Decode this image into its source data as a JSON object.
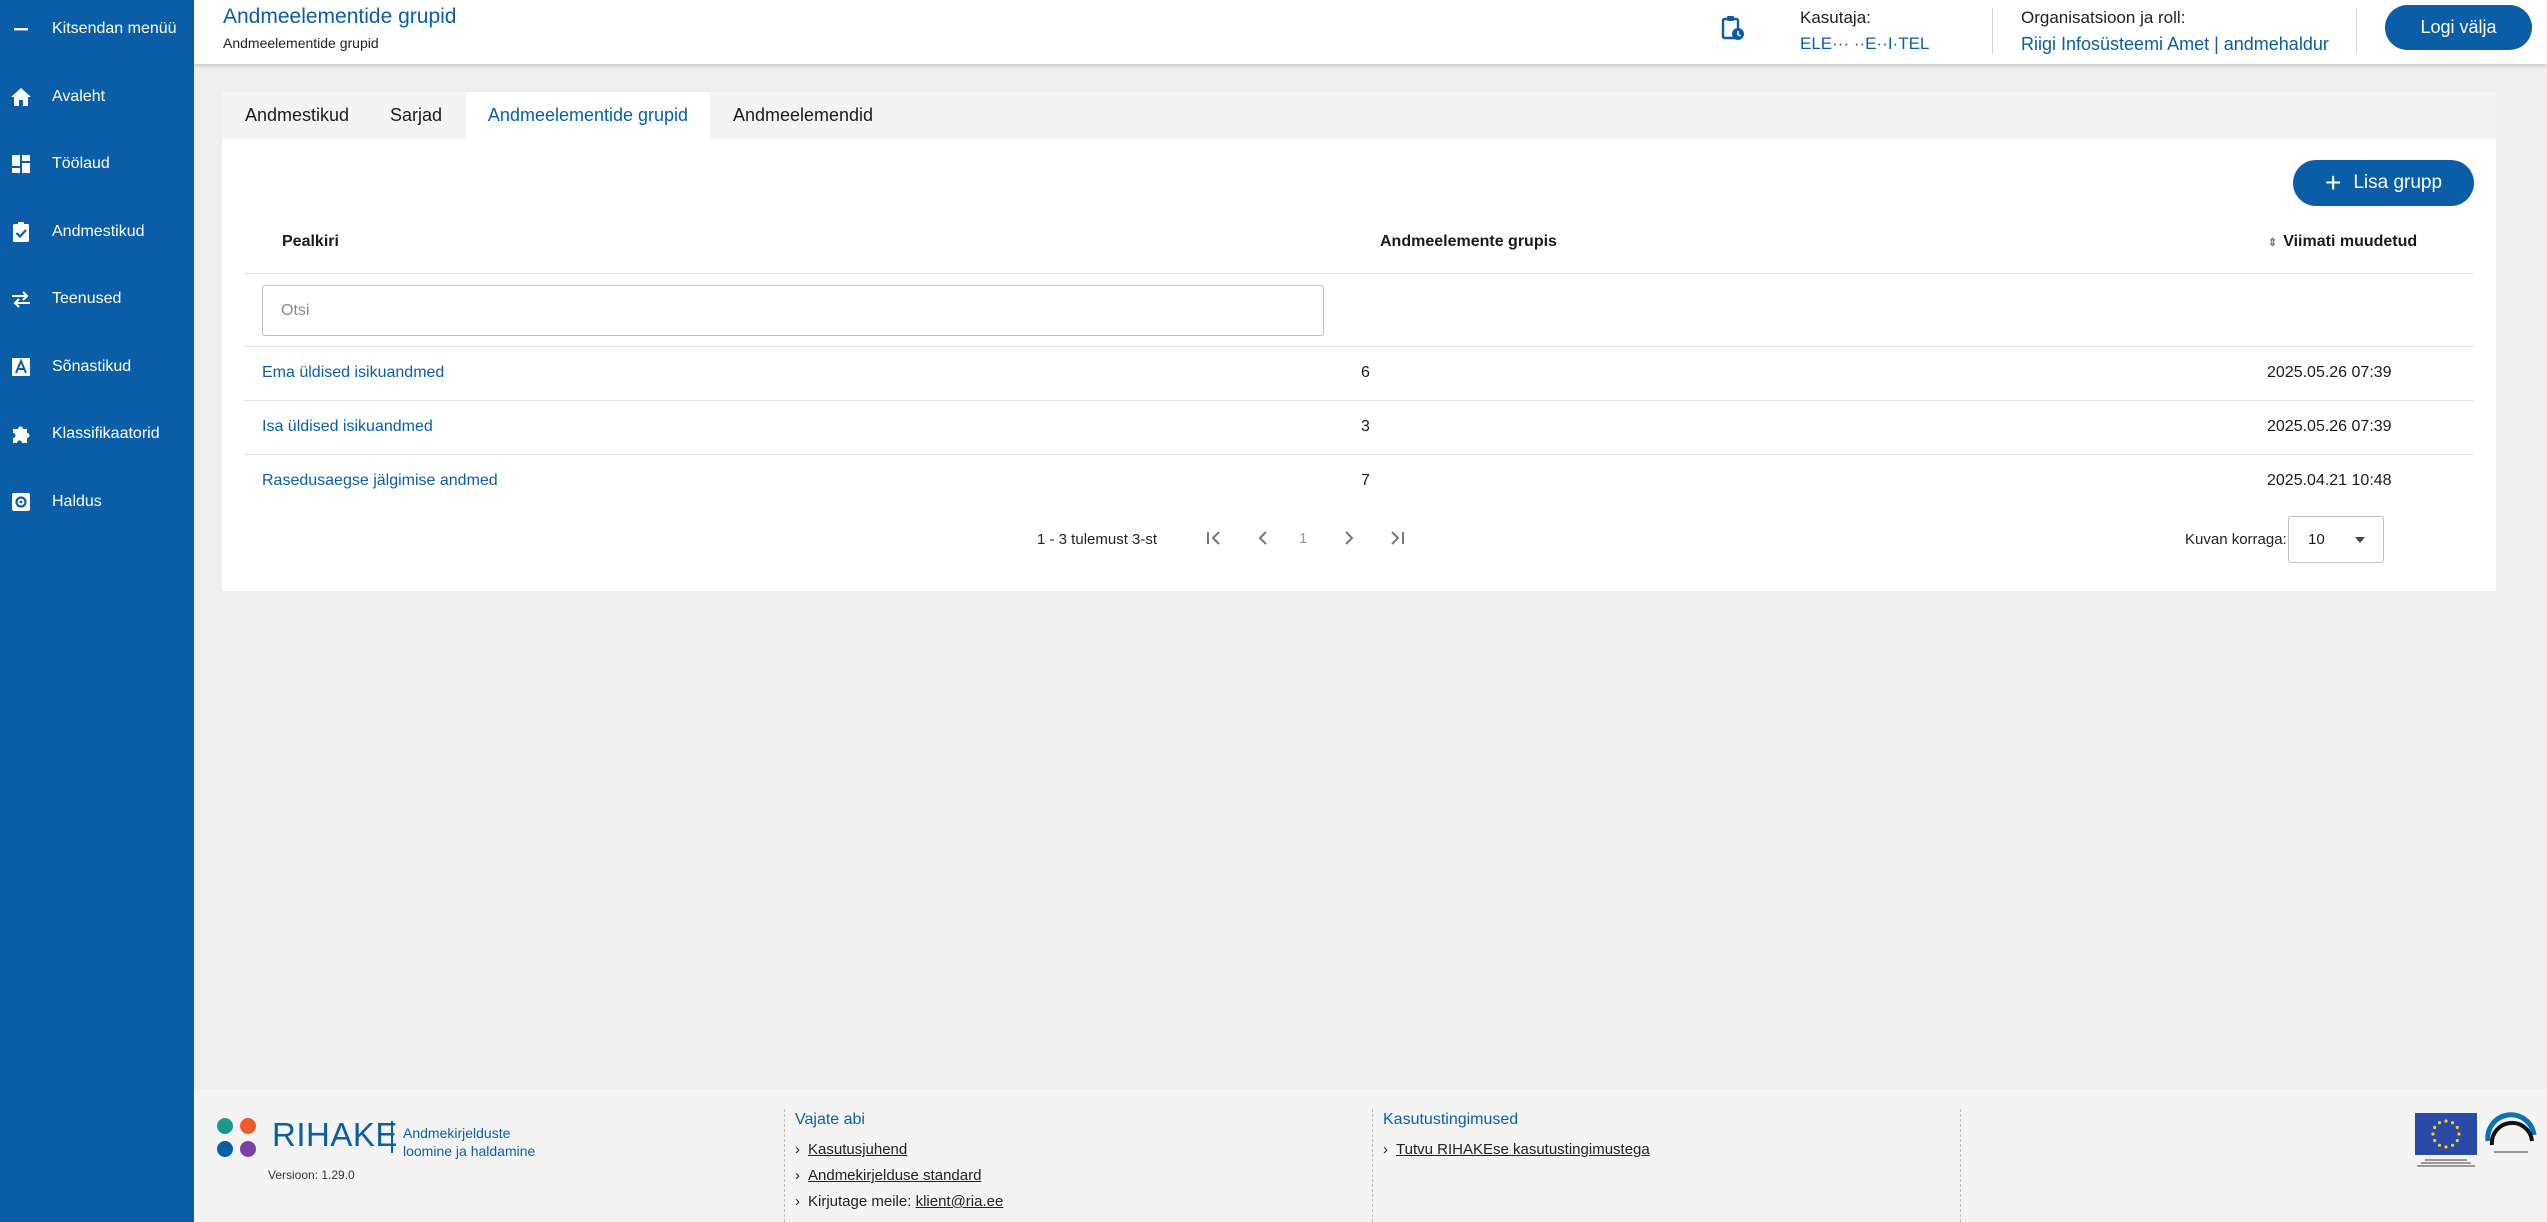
{
  "sidebar": {
    "items": [
      {
        "label": "Kitsendan menüü",
        "icon": "minus-icon"
      },
      {
        "label": "Avaleht",
        "icon": "home-icon"
      },
      {
        "label": "Töölaud",
        "icon": "dashboard-icon"
      },
      {
        "label": "Andmestikud",
        "icon": "clipboard-check-icon"
      },
      {
        "label": "Teenused",
        "icon": "swap-arrows-icon"
      },
      {
        "label": "Sõnastikud",
        "icon": "letter-a-icon"
      },
      {
        "label": "Klassifikaatorid",
        "icon": "puzzle-icon"
      },
      {
        "label": "Haldus",
        "icon": "admin-icon"
      }
    ]
  },
  "header": {
    "title": "Andmeelementide grupid",
    "breadcrumb": "Andmeelementide grupid",
    "user_label": "Kasutaja:",
    "user_name": "ELE··· ··E··I·TEL",
    "org_label": "Organisatsioon ja roll:",
    "org_value": "Riigi Infosüsteemi Amet | andmehaldur",
    "logout_label": "Logi välja"
  },
  "tabs": [
    {
      "label": "Andmestikud",
      "active": false
    },
    {
      "label": "Sarjad",
      "active": false
    },
    {
      "label": "Andmeelementide grupid",
      "active": true
    },
    {
      "label": "Andmeelemendid",
      "active": false
    }
  ],
  "add_button_label": "Lisa grupp",
  "table": {
    "columns": [
      "Pealkiri",
      "Andmeelemente grupis",
      "Viimati muudetud"
    ],
    "search_placeholder": "Otsi",
    "rows": [
      {
        "title": "Ema üldised isikuandmed",
        "count": "6",
        "modified": "2025.05.26 07:39"
      },
      {
        "title": "Isa üldised isikuandmed",
        "count": "3",
        "modified": "2025.05.26 07:39"
      },
      {
        "title": "Rasedusaegse jälgimise andmed",
        "count": "7",
        "modified": "2025.04.21 10:48"
      }
    ]
  },
  "pagination": {
    "info": "1 - 3 tulemust 3-st",
    "current_page": "1",
    "per_page_label": "Kuvan korraga:",
    "per_page_value": "10"
  },
  "footer": {
    "logo_text": "RIHAKE",
    "logo_sub_1": "Andmekirjelduste",
    "logo_sub_2": "loomine ja haldamine",
    "version": "Versioon: 1.29.0",
    "help_title": "Vajate abi",
    "help_links": [
      "Kasutusjuhend",
      "Andmekirjelduse standard"
    ],
    "email_prefix": "Kirjutage meile:",
    "email": "klient@ria.ee",
    "terms_title": "Kasutustingimused",
    "terms_link": "Tutvu RIHAKEse kasutustingimustega"
  },
  "colors": {
    "primary": "#0a5ea8",
    "background": "#efeff0",
    "surface": "#ffffff"
  }
}
